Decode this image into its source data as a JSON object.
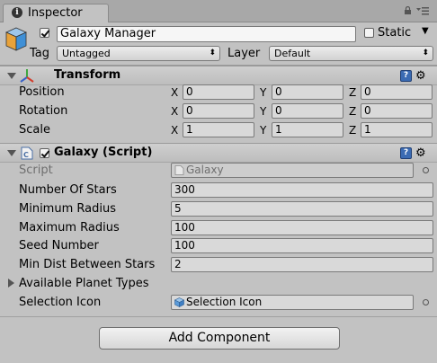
{
  "window": {
    "tab_label": "Inspector",
    "tab_icon": "info-icon"
  },
  "object": {
    "active": true,
    "name": "Galaxy Manager",
    "static_label": "Static",
    "static_checked": false,
    "tag_label": "Tag",
    "tag_value": "Untagged",
    "layer_label": "Layer",
    "layer_value": "Default"
  },
  "transform": {
    "title": "Transform",
    "rows": [
      {
        "label": "Position",
        "x": "0",
        "y": "0",
        "z": "0"
      },
      {
        "label": "Rotation",
        "x": "0",
        "y": "0",
        "z": "0"
      },
      {
        "label": "Scale",
        "x": "1",
        "y": "1",
        "z": "1"
      }
    ],
    "axis_labels": {
      "x": "X",
      "y": "Y",
      "z": "Z"
    }
  },
  "script_component": {
    "title": "Galaxy (Script)",
    "enabled": true,
    "script_label": "Script",
    "script_value": "Galaxy",
    "fields": [
      {
        "label": "Number Of Stars",
        "value": "300"
      },
      {
        "label": "Minimum Radius",
        "value": "5"
      },
      {
        "label": "Maximum Radius",
        "value": "100"
      },
      {
        "label": "Seed Number",
        "value": "100"
      },
      {
        "label": "Min Dist Between Stars",
        "value": "2"
      }
    ],
    "available_planet_types_label": "Available Planet Types",
    "selection_icon_label": "Selection Icon",
    "selection_icon_value": "Selection Icon"
  },
  "add_component_label": "Add Component",
  "colors": {
    "panel": "#c2c2c2",
    "accent_blue": "#3b6bb3"
  }
}
